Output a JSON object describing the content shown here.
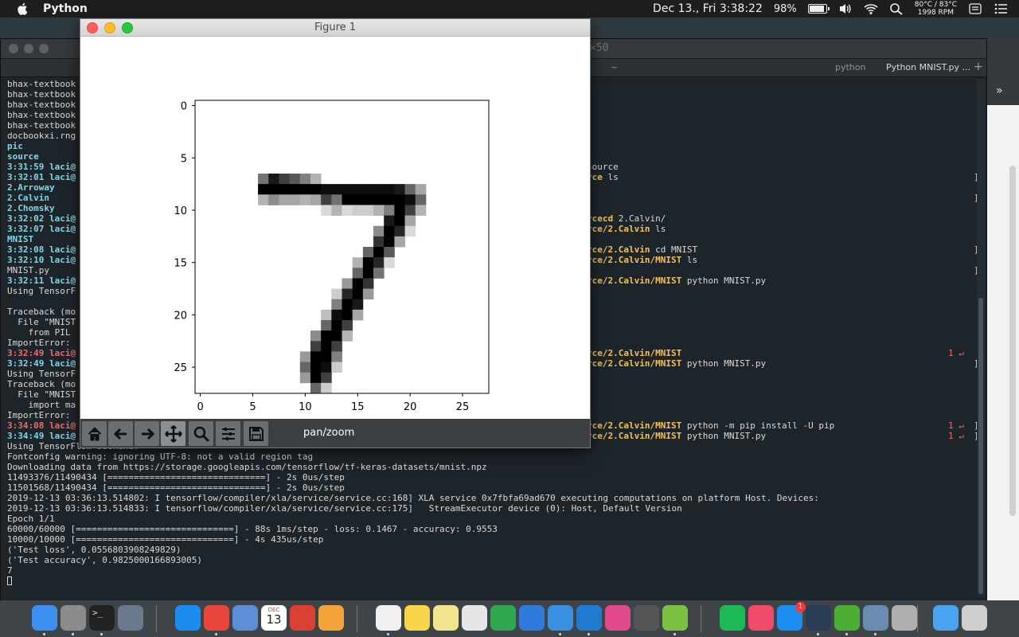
{
  "menubar": {
    "app_name": "Python",
    "clock": "Dec 13., Fri  3:38:22",
    "battery_percent": "98%",
    "battery_level": 0.98,
    "temp_line1": "80°C / 83°C",
    "temp_line2": "1998 RPM"
  },
  "terminal": {
    "title": "×50",
    "tabs": [
      "~",
      "python",
      "Python MNIST.py ..."
    ],
    "left_lines": [
      {
        "t": "bhax-textbook",
        "c": ""
      },
      {
        "t": "bhax-textbook",
        "c": ""
      },
      {
        "t": "bhax-textbook",
        "c": ""
      },
      {
        "t": "bhax-textbook",
        "c": ""
      },
      {
        "t": "bhax-textbook",
        "c": ""
      },
      {
        "t": "docbookxi.rng",
        "c": ""
      },
      {
        "t": "pic",
        "c": "cy"
      },
      {
        "t": "source",
        "c": "cy"
      },
      {
        "t": "3:31:59 laci@",
        "c": "cy"
      },
      {
        "t": "3:32:01 laci@",
        "c": "cy"
      },
      {
        "t": "2.Arroway",
        "c": "cy"
      },
      {
        "t": "2.Calvin",
        "c": "cy"
      },
      {
        "t": "2.Chomsky",
        "c": "cy"
      },
      {
        "t": "3:32:02 laci@",
        "c": "cy"
      },
      {
        "t": "3:32:07 laci@",
        "c": "cy"
      },
      {
        "t": "MNIST",
        "c": "cy"
      },
      {
        "t": "3:32:08 laci@",
        "c": "cy"
      },
      {
        "t": "3:32:10 laci@",
        "c": "cy"
      },
      {
        "t": "MNIST.py",
        "c": ""
      },
      {
        "t": "3:32:11 laci@",
        "c": "cy"
      },
      {
        "t": "Using TensorF",
        "c": ""
      },
      {
        "t": "",
        "c": ""
      },
      {
        "t": "Traceback (mo",
        "c": ""
      },
      {
        "t": "  File \"MNIST",
        "c": ""
      },
      {
        "t": "    from PIL",
        "c": ""
      },
      {
        "t": "ImportError:",
        "c": ""
      },
      {
        "t": "3:32:49 laci@",
        "c": "rd"
      },
      {
        "t": "3:32:49 laci@",
        "c": "cy"
      },
      {
        "t": "Using TensorF",
        "c": ""
      },
      {
        "t": "Traceback (mo",
        "c": ""
      },
      {
        "t": "  File \"MNIST",
        "c": ""
      },
      {
        "t": "    import ma",
        "c": ""
      },
      {
        "t": "ImportError:",
        "c": ""
      },
      {
        "t": "3:34:08 laci@",
        "c": "rd"
      },
      {
        "t": "3:34:49 laci@",
        "c": "cy"
      }
    ],
    "right_lines": [
      {
        "row": 8,
        "t": "source",
        "c": ""
      },
      {
        "row": 9,
        "t": "rce ls",
        "c": "yw"
      },
      {
        "row": 13,
        "t": "rcecd 2.Calvin/",
        "c": "yw"
      },
      {
        "row": 14,
        "t": "rce/2.Calvin ls",
        "c": "yw"
      },
      {
        "row": 16,
        "t": "rce/2.Calvin cd MNIST",
        "c": "yw"
      },
      {
        "row": 17,
        "t": "rce/2.Calvin/MNIST ls",
        "c": "yw"
      },
      {
        "row": 19,
        "t": "rce/2.Calvin/MNIST python MNIST.py",
        "c": "yw"
      },
      {
        "row": 26,
        "t": "rce/2.Calvin/MNIST",
        "c": "yw"
      },
      {
        "row": 27,
        "t": "rce/2.Calvin/MNIST python MNIST.py",
        "c": "yw"
      },
      {
        "row": 33,
        "t": "rce/2.Calvin/MNIST python -m pip install -U pip",
        "c": "yw"
      },
      {
        "row": 34,
        "t": "rce/2.Calvin/MNIST python MNIST.py",
        "c": "yw"
      }
    ],
    "retcodes": [
      26,
      33,
      34
    ],
    "retcode_label": "1 ↵",
    "bottom_lines": [
      "Using TensorFlow backend.",
      "Fontconfig warning: ignoring UTF-8: not a valid region tag",
      "Downloading data from https://storage.googleapis.com/tensorflow/tf-keras-datasets/mnist.npz",
      "11493376/11490434 [==============================] - 2s 0us/step",
      "11501568/11490434 [==============================] - 2s 0us/step",
      "2019-12-13 03:36:13.514802: I tensorflow/compiler/xla/service/service.cc:168] XLA service 0x7fbfa69ad670 executing computations on platform Host. Devices:",
      "2019-12-13 03:36:13.514833: I tensorflow/compiler/xla/service/service.cc:175]   StreamExecutor device (0): Host, Default Version",
      "Epoch 1/1",
      "60000/60000 [==============================] - 88s 1ms/step - loss: 0.1467 - accuracy: 0.9553",
      "10000/10000 [==============================] - 4s 435us/step",
      "('Test loss', 0.0556803908249829)",
      "('Test accuracy', 0.9825000166893005)",
      "7"
    ]
  },
  "figure": {
    "title": "Figure 1",
    "toolbar_message": "pan/zoom",
    "toolbar_buttons": [
      "home-icon",
      "back-icon",
      "forward-icon",
      "pan-icon",
      "zoom-icon",
      "configure-subplots-icon",
      "save-icon"
    ]
  },
  "chart_data": {
    "type": "heatmap",
    "title": "",
    "xlabel": "",
    "ylabel": "",
    "xlim": [
      -0.5,
      27.5
    ],
    "ylim": [
      27.5,
      -0.5
    ],
    "xticks": [
      0,
      5,
      10,
      15,
      20,
      25
    ],
    "yticks": [
      0,
      5,
      10,
      15,
      20,
      25
    ],
    "colormap": "gray_r",
    "rows": 28,
    "cols": 28,
    "pixels": [
      [
        7,
        6,
        0.55
      ],
      [
        7,
        7,
        0.9
      ],
      [
        7,
        8,
        0.75
      ],
      [
        7,
        9,
        0.65
      ],
      [
        7,
        10,
        0.5
      ],
      [
        7,
        11,
        0.3
      ],
      [
        8,
        6,
        1
      ],
      [
        8,
        7,
        1
      ],
      [
        8,
        8,
        1
      ],
      [
        8,
        9,
        1
      ],
      [
        8,
        10,
        1
      ],
      [
        8,
        11,
        1
      ],
      [
        8,
        12,
        0.95
      ],
      [
        8,
        13,
        0.95
      ],
      [
        8,
        14,
        0.95
      ],
      [
        8,
        15,
        0.95
      ],
      [
        8,
        16,
        0.95
      ],
      [
        8,
        17,
        0.95
      ],
      [
        8,
        18,
        0.95
      ],
      [
        8,
        19,
        0.9
      ],
      [
        8,
        20,
        0.6
      ],
      [
        8,
        21,
        0.35
      ],
      [
        9,
        6,
        0.3
      ],
      [
        9,
        7,
        0.45
      ],
      [
        9,
        8,
        0.35
      ],
      [
        9,
        9,
        0.35
      ],
      [
        9,
        10,
        0.3
      ],
      [
        9,
        11,
        0.35
      ],
      [
        9,
        12,
        0.75
      ],
      [
        9,
        13,
        0.55
      ],
      [
        9,
        14,
        1
      ],
      [
        9,
        15,
        1
      ],
      [
        9,
        16,
        1
      ],
      [
        9,
        17,
        1
      ],
      [
        9,
        18,
        1
      ],
      [
        9,
        19,
        1
      ],
      [
        9,
        20,
        0.95
      ],
      [
        9,
        21,
        0.6
      ],
      [
        10,
        12,
        0.15
      ],
      [
        10,
        13,
        0.3
      ],
      [
        10,
        14,
        0.15
      ],
      [
        10,
        15,
        0.2
      ],
      [
        10,
        16,
        0.2
      ],
      [
        10,
        17,
        0.3
      ],
      [
        10,
        18,
        0.5
      ],
      [
        10,
        19,
        1
      ],
      [
        10,
        20,
        0.75
      ],
      [
        10,
        21,
        0.3
      ],
      [
        11,
        18,
        0.9
      ],
      [
        11,
        19,
        1
      ],
      [
        11,
        20,
        0.35
      ],
      [
        12,
        17,
        0.45
      ],
      [
        12,
        18,
        1
      ],
      [
        12,
        19,
        0.85
      ],
      [
        12,
        20,
        0.15
      ],
      [
        13,
        17,
        0.8
      ],
      [
        13,
        18,
        1
      ],
      [
        13,
        19,
        0.35
      ],
      [
        14,
        16,
        0.6
      ],
      [
        14,
        17,
        1
      ],
      [
        14,
        18,
        0.65
      ],
      [
        15,
        15,
        0.3
      ],
      [
        15,
        16,
        1
      ],
      [
        15,
        17,
        0.85
      ],
      [
        15,
        18,
        0.15
      ],
      [
        16,
        15,
        0.6
      ],
      [
        16,
        16,
        1
      ],
      [
        16,
        17,
        0.55
      ],
      [
        17,
        14,
        0.4
      ],
      [
        17,
        15,
        1
      ],
      [
        17,
        16,
        0.8
      ],
      [
        18,
        13,
        0.2
      ],
      [
        18,
        14,
        0.85
      ],
      [
        18,
        15,
        1
      ],
      [
        18,
        16,
        0.4
      ],
      [
        19,
        13,
        0.5
      ],
      [
        19,
        14,
        1
      ],
      [
        19,
        15,
        0.9
      ],
      [
        20,
        12,
        0.25
      ],
      [
        20,
        13,
        0.95
      ],
      [
        20,
        14,
        1
      ],
      [
        20,
        15,
        0.35
      ],
      [
        21,
        12,
        0.6
      ],
      [
        21,
        13,
        1
      ],
      [
        21,
        14,
        0.75
      ],
      [
        22,
        11,
        0.45
      ],
      [
        22,
        12,
        1
      ],
      [
        22,
        13,
        1
      ],
      [
        22,
        14,
        0.3
      ],
      [
        23,
        11,
        0.75
      ],
      [
        23,
        12,
        1
      ],
      [
        23,
        13,
        0.75
      ],
      [
        24,
        10,
        0.4
      ],
      [
        24,
        11,
        1
      ],
      [
        24,
        12,
        1
      ],
      [
        24,
        13,
        0.5
      ],
      [
        25,
        10,
        0.6
      ],
      [
        25,
        11,
        1
      ],
      [
        25,
        12,
        0.95
      ],
      [
        25,
        13,
        0.2
      ],
      [
        26,
        10,
        0.4
      ],
      [
        26,
        11,
        1
      ],
      [
        26,
        12,
        0.75
      ],
      [
        27,
        11,
        0.6
      ],
      [
        27,
        12,
        0.2
      ]
    ]
  },
  "dock": {
    "apps": [
      {
        "name": "finder",
        "color": "#3d8ff0"
      },
      {
        "name": "system-preferences",
        "color": "#8c8c8c"
      },
      {
        "name": "terminal",
        "color": "#222222"
      },
      {
        "name": "launchpad",
        "color": "#6b7a8f"
      },
      {
        "name": "safari",
        "color": "#1a8cf0"
      },
      {
        "name": "chrome",
        "color": "#e8453c"
      },
      {
        "name": "preview",
        "color": "#5d8fd6"
      },
      {
        "name": "calendar",
        "color": "#ffffff"
      },
      {
        "name": "todoist",
        "color": "#db4035"
      },
      {
        "name": "photos",
        "color": "#f3a43b"
      },
      {
        "name": "reminders",
        "color": "#f0f0f0"
      },
      {
        "name": "notes",
        "color": "#f7d54a"
      },
      {
        "name": "stickies",
        "color": "#f2e48c"
      },
      {
        "name": "textedit",
        "color": "#e6e6e6"
      },
      {
        "name": "numbers",
        "color": "#2fa84f"
      },
      {
        "name": "keynote",
        "color": "#2f7bdc"
      },
      {
        "name": "xcode",
        "color": "#3a8fe0"
      },
      {
        "name": "vscode",
        "color": "#1f7bd0"
      },
      {
        "name": "affinity",
        "color": "#e04a8b"
      },
      {
        "name": "lab",
        "color": "#555555"
      },
      {
        "name": "android-studio",
        "color": "#7cc142"
      },
      {
        "name": "spotify",
        "color": "#1db954"
      },
      {
        "name": "music",
        "color": "#f04a6c"
      },
      {
        "name": "app-store",
        "color": "#1c8ef0"
      },
      {
        "name": "steam",
        "color": "#2a3d55"
      },
      {
        "name": "utorrent",
        "color": "#4cae34"
      },
      {
        "name": "image-capture",
        "color": "#6b8cb0"
      },
      {
        "name": "rocket",
        "color": "#b0b0b0"
      },
      {
        "name": "downloads-folder",
        "color": "#4aa3f0"
      },
      {
        "name": "trash",
        "color": "#cfcfcf"
      }
    ],
    "calendar_month": "DEC",
    "calendar_day": "13",
    "appstore_badge": "1"
  }
}
